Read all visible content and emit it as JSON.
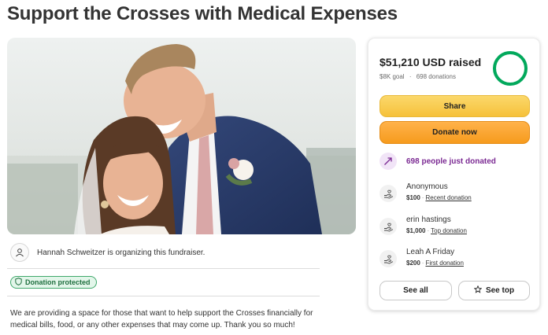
{
  "page": {
    "title": "Support the Crosses with Medical Expenses"
  },
  "organizer": {
    "text": "Hannah Schweitzer is organizing this fundraiser.",
    "icon": "user-icon"
  },
  "badge": {
    "label": "Donation protected",
    "icon": "shield-icon"
  },
  "description": {
    "text": "We are providing a space for those that want to help support the Crosses financially for medical bills, food, or any other expenses that may come up. Thank you so much!"
  },
  "donation_card": {
    "raised": "$51,210 USD raised",
    "goal": "$8K goal",
    "separator": "·",
    "donations": "698 donations",
    "progress_fraction": 1.0,
    "share_label": "Share",
    "donate_label": "Donate now",
    "recent_count_text": "698 people just donated",
    "donors": [
      {
        "name": "Anonymous",
        "amount": "$100",
        "tag": "Recent donation"
      },
      {
        "name": "erin hastings",
        "amount": "$1,000",
        "tag": "Top donation"
      },
      {
        "name": "Leah A Friday",
        "amount": "$200",
        "tag": "First donation"
      }
    ],
    "see_all_label": "See all",
    "see_top_label": "See top"
  },
  "colors": {
    "progress": "#02a95c",
    "share_button": "#f6c13a",
    "donate_button": "#f69b1d",
    "trend_text": "#7b2a93",
    "badge_green": "#3fa86b"
  }
}
